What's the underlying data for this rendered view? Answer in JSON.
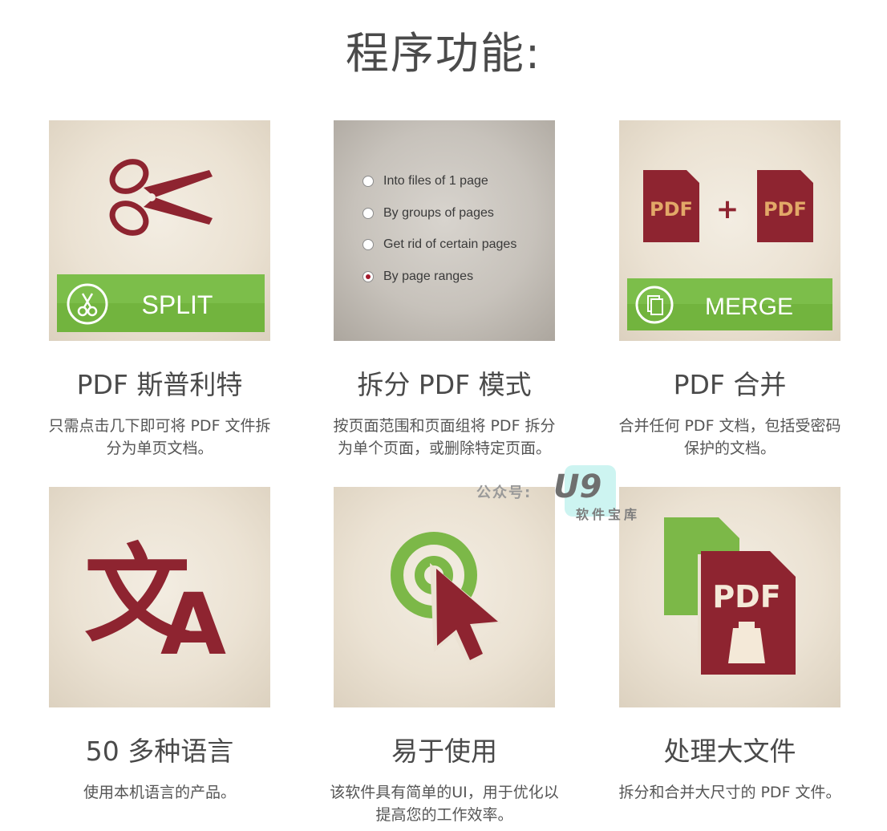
{
  "page": {
    "title": "程序功能:"
  },
  "features": [
    {
      "title": "PDF 斯普利特",
      "desc_line1": "只需点击几下即可将 PDF 文件拆",
      "desc_line2": "分为单页文档。",
      "button_label": "SPLIT",
      "icon": "scissors-icon"
    },
    {
      "title": "拆分 PDF 模式",
      "desc_line1": "按页面范围和页面组将 PDF 拆分",
      "desc_line2": "为单个页面，或删除特定页面。",
      "options": [
        {
          "label": "Into files of 1 page",
          "checked": false
        },
        {
          "label": "By groups of pages",
          "checked": false
        },
        {
          "label": "Get rid of certain pages",
          "checked": false
        },
        {
          "label": "By page ranges",
          "checked": true
        }
      ]
    },
    {
      "title": "PDF 合并",
      "desc_line1": "合并任何 PDF 文档，包括受密码",
      "desc_line2": "保护的文档。",
      "button_label": "MERGE",
      "doc_label_left": "PDF",
      "plus": "+",
      "doc_label_right": "PDF",
      "icon": "merge-icon"
    },
    {
      "title": "50 多种语言",
      "desc_line1": "使用本机语言的产品。",
      "desc_line2": "",
      "icon": "translate-icon",
      "glyph_cn": "文",
      "glyph_latin": "A"
    },
    {
      "title": "易于使用",
      "desc_line1": "该软件具有简单的UI，用于优化以",
      "desc_line2": "提高您的工作效率。",
      "icon": "pointer-click-icon"
    },
    {
      "title": "处理大文件",
      "desc_line1": "拆分和合并大尺寸的 PDF 文件。",
      "desc_line2": "",
      "doc_label": "PDF",
      "icon": "heavy-file-icon"
    }
  ],
  "watermark": {
    "prefix": "公众号:",
    "logo": "U9",
    "subtitle": "软件宝库"
  },
  "colors": {
    "brand_red": "#8e2430",
    "green": "#7cb848",
    "accent_text": "#e2a868",
    "tile_bg": "#ede5d7"
  }
}
